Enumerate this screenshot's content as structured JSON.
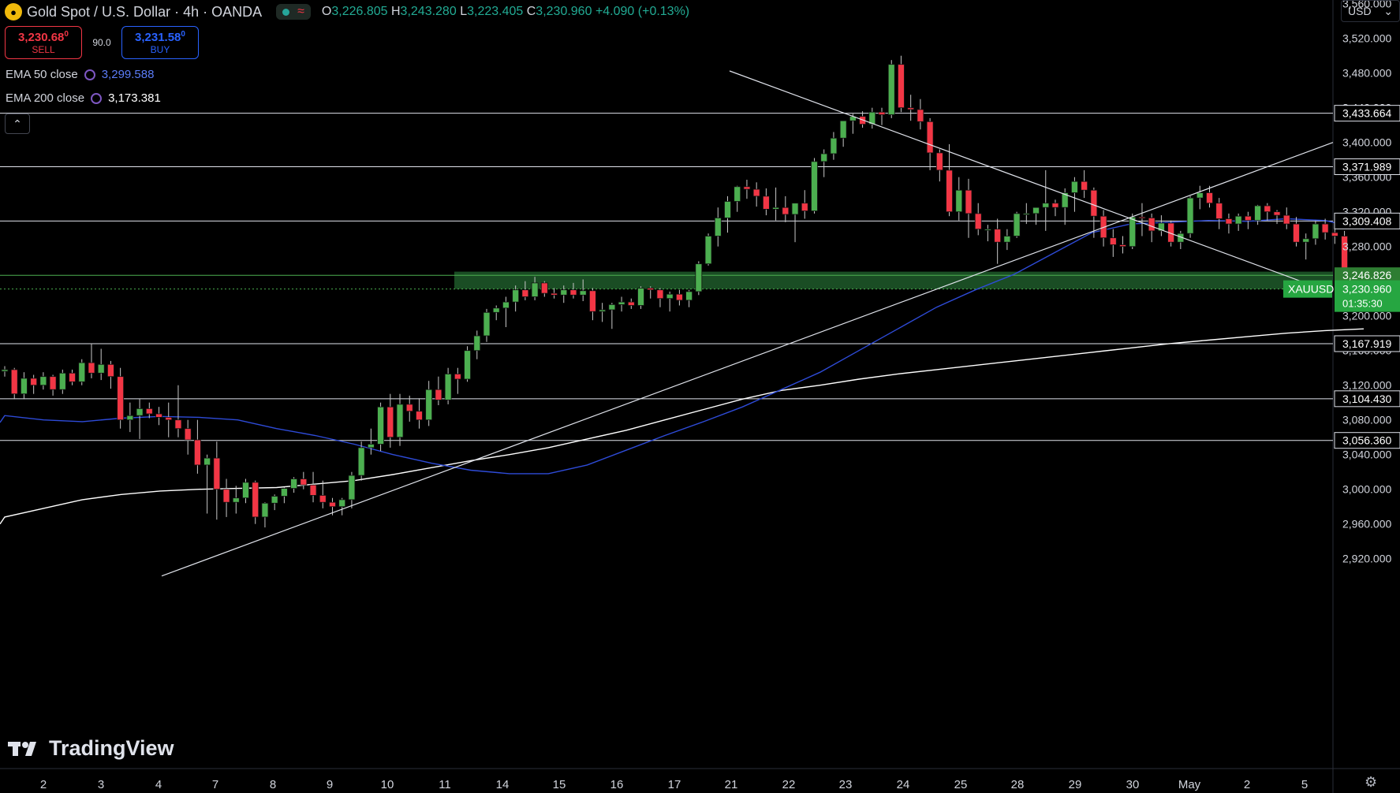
{
  "header": {
    "title": "Gold Spot / U.S. Dollar · 4h · OANDA",
    "symbol_icon": "gold-coin-icon",
    "ohlc": {
      "o_label": "O",
      "o": "3,226.805",
      "h_label": "H",
      "h": "3,243.280",
      "l_label": "L",
      "l": "3,223.405",
      "c_label": "C",
      "c": "3,230.960",
      "change": "+4.090 (+0.13%)"
    }
  },
  "trade": {
    "sell_price": "3,230.68",
    "sell_sup": "0",
    "sell_label": "SELL",
    "spread": "90.0",
    "buy_price": "3,231.58",
    "buy_sup": "0",
    "buy_label": "BUY"
  },
  "indicators": [
    {
      "label": "EMA 50 close",
      "value": "3,299.588",
      "color": "#5b7cf7"
    },
    {
      "label": "EMA 200 close",
      "value": "3,173.381",
      "color": "#ffffff"
    }
  ],
  "currency": "USD",
  "logo_text": "TradingView",
  "colors": {
    "up": "#4caf50",
    "down": "#f23645",
    "ema50": "#2e4bd8",
    "ema200": "#ffffff",
    "zone": "#1e5a2a",
    "last_price_tag": "#26a641"
  },
  "chart_data": {
    "type": "candlestick",
    "symbol": "XAUUSD",
    "interval": "4h",
    "y_range": [
      2890,
      3590
    ],
    "y_ticks": [
      "3,560.000",
      "3,520.000",
      "3,480.000",
      "3,440.000",
      "3,400.000",
      "3,360.000",
      "3,320.000",
      "3,280.000",
      "3,240.000",
      "3,200.000",
      "3,160.000",
      "3,120.000",
      "3,080.000",
      "3,040.000",
      "3,000.000",
      "2,960.000",
      "2,920.000"
    ],
    "x_labels": [
      "2",
      "3",
      "4",
      "7",
      "8",
      "9",
      "10",
      "11",
      "14",
      "15",
      "16",
      "17",
      "21",
      "22",
      "23",
      "24",
      "25",
      "28",
      "29",
      "30",
      "May",
      "2",
      "5"
    ],
    "levels": [
      {
        "label": "3,433.664",
        "value": 3433.664
      },
      {
        "label": "3,371.989",
        "value": 3371.989
      },
      {
        "label": "3,309.408",
        "value": 3309.408
      },
      {
        "label": "3,167.919",
        "value": 3167.919
      },
      {
        "label": "3,104.430",
        "value": 3104.43
      },
      {
        "label": "3,056.360",
        "value": 3056.36
      }
    ],
    "zone_level": {
      "label": "3,246.826",
      "value": 3246.826
    },
    "zone": {
      "from": 3231,
      "to": 3251
    },
    "last_price": {
      "symbol": "XAUUSD",
      "label": "3,230.960",
      "countdown": "01:35:30",
      "value": 3230.96
    },
    "candles": [
      [
        3136,
        3142,
        3130,
        3138
      ],
      [
        3138,
        3140,
        3104,
        3110
      ],
      [
        3110,
        3135,
        3104,
        3128
      ],
      [
        3128,
        3132,
        3110,
        3120
      ],
      [
        3120,
        3135,
        3115,
        3130
      ],
      [
        3130,
        3132,
        3108,
        3115
      ],
      [
        3115,
        3138,
        3110,
        3134
      ],
      [
        3134,
        3138,
        3120,
        3124
      ],
      [
        3124,
        3150,
        3120,
        3146
      ],
      [
        3146,
        3168,
        3128,
        3134
      ],
      [
        3134,
        3162,
        3126,
        3144
      ],
      [
        3144,
        3148,
        3116,
        3130
      ],
      [
        3130,
        3140,
        3070,
        3080
      ],
      [
        3080,
        3100,
        3066,
        3085
      ],
      [
        3085,
        3104,
        3058,
        3093
      ],
      [
        3093,
        3100,
        3082,
        3087
      ],
      [
        3087,
        3095,
        3074,
        3083
      ],
      [
        3083,
        3100,
        3060,
        3080
      ],
      [
        3080,
        3120,
        3060,
        3070
      ],
      [
        3070,
        3080,
        3040,
        3057
      ],
      [
        3057,
        3080,
        3018,
        3028
      ],
      [
        3028,
        3040,
        2972,
        3036
      ],
      [
        3036,
        3055,
        2965,
        3000
      ],
      [
        3000,
        3012,
        2968,
        2985
      ],
      [
        2985,
        3004,
        2972,
        2990
      ],
      [
        2990,
        3012,
        2984,
        3008
      ],
      [
        3008,
        3010,
        2960,
        2968
      ],
      [
        2968,
        2985,
        2956,
        2984
      ],
      [
        2984,
        2994,
        2976,
        2992
      ],
      [
        2992,
        3002,
        2984,
        3001
      ],
      [
        3001,
        3014,
        2996,
        3012
      ],
      [
        3012,
        3020,
        3000,
        3005
      ],
      [
        3005,
        3020,
        2985,
        2993
      ],
      [
        2993,
        3010,
        2978,
        2985
      ],
      [
        2985,
        2990,
        2970,
        2980
      ],
      [
        2980,
        2990,
        2970,
        2988
      ],
      [
        2988,
        3020,
        2978,
        3016
      ],
      [
        3016,
        3055,
        3010,
        3048
      ],
      [
        3048,
        3070,
        3040,
        3052
      ],
      [
        3052,
        3100,
        3044,
        3095
      ],
      [
        3095,
        3110,
        3048,
        3060
      ],
      [
        3060,
        3110,
        3050,
        3098
      ],
      [
        3098,
        3108,
        3078,
        3090
      ],
      [
        3090,
        3105,
        3070,
        3080
      ],
      [
        3080,
        3125,
        3073,
        3115
      ],
      [
        3115,
        3130,
        3097,
        3103
      ],
      [
        3103,
        3140,
        3098,
        3133
      ],
      [
        3133,
        3140,
        3110,
        3127
      ],
      [
        3127,
        3165,
        3124,
        3160
      ],
      [
        3160,
        3183,
        3150,
        3177
      ],
      [
        3177,
        3208,
        3170,
        3204
      ],
      [
        3204,
        3212,
        3195,
        3209
      ],
      [
        3209,
        3222,
        3187,
        3216
      ],
      [
        3216,
        3235,
        3205,
        3230
      ],
      [
        3230,
        3240,
        3218,
        3222
      ],
      [
        3222,
        3245,
        3218,
        3238
      ],
      [
        3238,
        3240,
        3222,
        3226
      ],
      [
        3226,
        3232,
        3220,
        3224
      ],
      [
        3224,
        3235,
        3215,
        3230
      ],
      [
        3230,
        3238,
        3220,
        3224
      ],
      [
        3224,
        3242,
        3217,
        3229
      ],
      [
        3229,
        3232,
        3195,
        3205
      ],
      [
        3205,
        3215,
        3193,
        3207
      ],
      [
        3207,
        3215,
        3185,
        3213
      ],
      [
        3213,
        3222,
        3205,
        3216
      ],
      [
        3216,
        3220,
        3208,
        3212
      ],
      [
        3212,
        3234,
        3208,
        3232
      ],
      [
        3232,
        3234,
        3220,
        3230
      ],
      [
        3230,
        3232,
        3210,
        3220
      ],
      [
        3220,
        3228,
        3205,
        3225
      ],
      [
        3225,
        3230,
        3212,
        3218
      ],
      [
        3218,
        3230,
        3210,
        3228
      ],
      [
        3228,
        3263,
        3224,
        3260
      ],
      [
        3260,
        3295,
        3258,
        3292
      ],
      [
        3292,
        3325,
        3280,
        3313
      ],
      [
        3313,
        3338,
        3296,
        3332
      ],
      [
        3332,
        3350,
        3320,
        3349
      ],
      [
        3349,
        3357,
        3335,
        3346
      ],
      [
        3346,
        3354,
        3326,
        3338
      ],
      [
        3338,
        3347,
        3316,
        3323
      ],
      [
        3323,
        3348,
        3310,
        3325
      ],
      [
        3325,
        3338,
        3308,
        3317
      ],
      [
        3317,
        3330,
        3285,
        3330
      ],
      [
        3330,
        3345,
        3312,
        3321
      ],
      [
        3321,
        3382,
        3318,
        3378
      ],
      [
        3378,
        3392,
        3360,
        3387
      ],
      [
        3387,
        3412,
        3380,
        3405
      ],
      [
        3405,
        3425,
        3395,
        3425
      ],
      [
        3425,
        3433,
        3410,
        3430
      ],
      [
        3430,
        3436,
        3417,
        3421
      ],
      [
        3421,
        3440,
        3416,
        3435
      ],
      [
        3435,
        3440,
        3420,
        3432
      ],
      [
        3432,
        3495,
        3428,
        3490
      ],
      [
        3490,
        3500,
        3435,
        3440
      ],
      [
        3440,
        3455,
        3425,
        3438
      ],
      [
        3438,
        3450,
        3415,
        3424
      ],
      [
        3424,
        3428,
        3368,
        3388
      ],
      [
        3388,
        3392,
        3355,
        3368
      ],
      [
        3368,
        3398,
        3315,
        3320
      ],
      [
        3320,
        3360,
        3310,
        3345
      ],
      [
        3345,
        3358,
        3290,
        3318
      ],
      [
        3318,
        3330,
        3293,
        3300
      ],
      [
        3300,
        3305,
        3286,
        3300
      ],
      [
        3300,
        3312,
        3260,
        3285
      ],
      [
        3285,
        3300,
        3276,
        3292
      ],
      [
        3292,
        3320,
        3290,
        3318
      ],
      [
        3318,
        3330,
        3306,
        3318
      ],
      [
        3318,
        3324,
        3305,
        3325
      ],
      [
        3325,
        3368,
        3298,
        3330
      ],
      [
        3330,
        3334,
        3315,
        3325
      ],
      [
        3325,
        3347,
        3305,
        3342
      ],
      [
        3342,
        3360,
        3320,
        3355
      ],
      [
        3355,
        3368,
        3336,
        3345
      ],
      [
        3345,
        3348,
        3290,
        3315
      ],
      [
        3315,
        3322,
        3280,
        3290
      ],
      [
        3290,
        3300,
        3268,
        3282
      ],
      [
        3282,
        3292,
        3272,
        3280
      ],
      [
        3280,
        3318,
        3277,
        3314
      ],
      [
        3314,
        3330,
        3292,
        3313
      ],
      [
        3313,
        3318,
        3285,
        3298
      ],
      [
        3298,
        3316,
        3292,
        3307
      ],
      [
        3307,
        3310,
        3280,
        3285
      ],
      [
        3285,
        3298,
        3277,
        3295
      ],
      [
        3295,
        3338,
        3290,
        3336
      ],
      [
        3336,
        3350,
        3323,
        3342
      ],
      [
        3342,
        3350,
        3325,
        3330
      ],
      [
        3330,
        3336,
        3300,
        3312
      ],
      [
        3312,
        3318,
        3295,
        3306
      ],
      [
        3306,
        3318,
        3298,
        3315
      ],
      [
        3315,
        3320,
        3300,
        3310
      ],
      [
        3310,
        3328,
        3305,
        3327
      ],
      [
        3327,
        3330,
        3310,
        3320
      ],
      [
        3320,
        3322,
        3306,
        3316
      ],
      [
        3316,
        3325,
        3300,
        3306
      ],
      [
        3306,
        3314,
        3280,
        3285
      ],
      [
        3285,
        3295,
        3265,
        3289
      ],
      [
        3289,
        3310,
        3282,
        3306
      ],
      [
        3306,
        3312,
        3288,
        3296
      ],
      [
        3296,
        3300,
        3283,
        3292
      ],
      [
        3292,
        3298,
        3248,
        3251
      ],
      [
        3251,
        3255,
        3222,
        3227
      ],
      [
        3227,
        3243,
        3223,
        3231
      ]
    ],
    "ema50": [
      3085,
      3080,
      3078,
      3082,
      3084,
      3083,
      3080,
      3070,
      3062,
      3052,
      3040,
      3030,
      3022,
      3018,
      3018,
      3028,
      3045,
      3062,
      3078,
      3095,
      3115,
      3135,
      3160,
      3185,
      3210,
      3230,
      3248,
      3272,
      3296,
      3306,
      3308,
      3310,
      3309,
      3312,
      3310,
      3300
    ],
    "ema200": [
      2968,
      2978,
      2988,
      2994,
      2998,
      3000,
      3001,
      3002,
      3006,
      3010,
      3017,
      3025,
      3033,
      3040,
      3048,
      3058,
      3068,
      3080,
      3092,
      3104,
      3114,
      3120,
      3127,
      3133,
      3138,
      3143,
      3148,
      3153,
      3158,
      3163,
      3168,
      3172,
      3176,
      3180,
      3183,
      3185
    ],
    "trendlines": [
      {
        "from": [
          3360,
          3534
        ],
        "to": [
          3520,
          3228
        ]
      },
      {
        "from": [
          3420,
          2905
        ],
        "to": [
          3510,
          3400
        ]
      }
    ]
  }
}
